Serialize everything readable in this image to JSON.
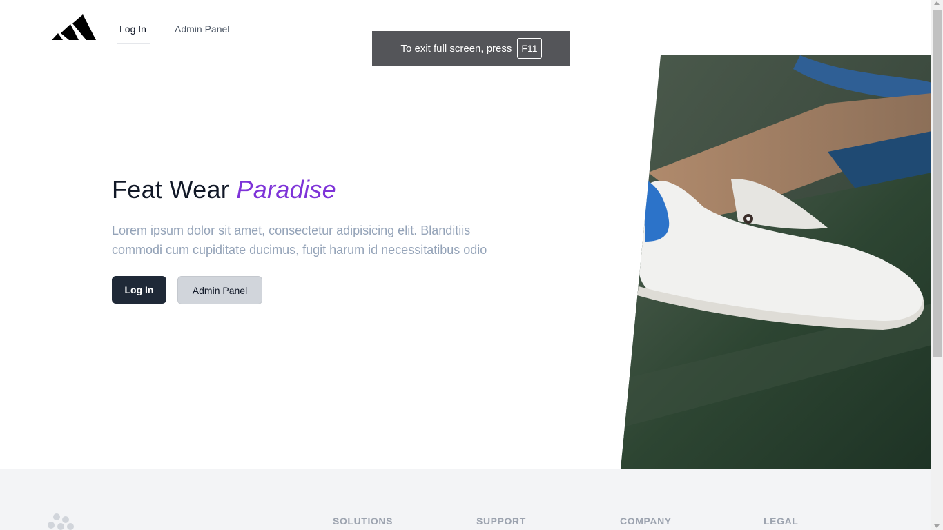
{
  "header": {
    "logo_icon": "adidas-stripes-logo",
    "nav": [
      {
        "label": "Log In"
      },
      {
        "label": "Admin Panel"
      }
    ]
  },
  "fullscreen_notice": {
    "text": "To exit full screen, press",
    "key": "F11"
  },
  "hero": {
    "title_plain": "Feat Wear",
    "title_accent": "Paradise",
    "description": "Lorem ipsum dolor sit amet, consectetur adipisicing elit. Blanditiis commodi cum cupiditate ducimus, fugit harum id necessitatibus odio",
    "login_button": "Log In",
    "admin_button": "Admin Panel",
    "image_icon": "sneaker-photo"
  },
  "footer": {
    "logo_icon": "footer-logo-icon",
    "headings": [
      {
        "label": "SOLUTIONS"
      },
      {
        "label": "SUPPORT"
      },
      {
        "label": "COMPANY"
      },
      {
        "label": "LEGAL"
      }
    ]
  },
  "colors": {
    "accent": "#7e33d8",
    "primary_button": "#1f2937",
    "secondary_button": "#d1d5db",
    "footer_bg": "#f3f4f6"
  }
}
